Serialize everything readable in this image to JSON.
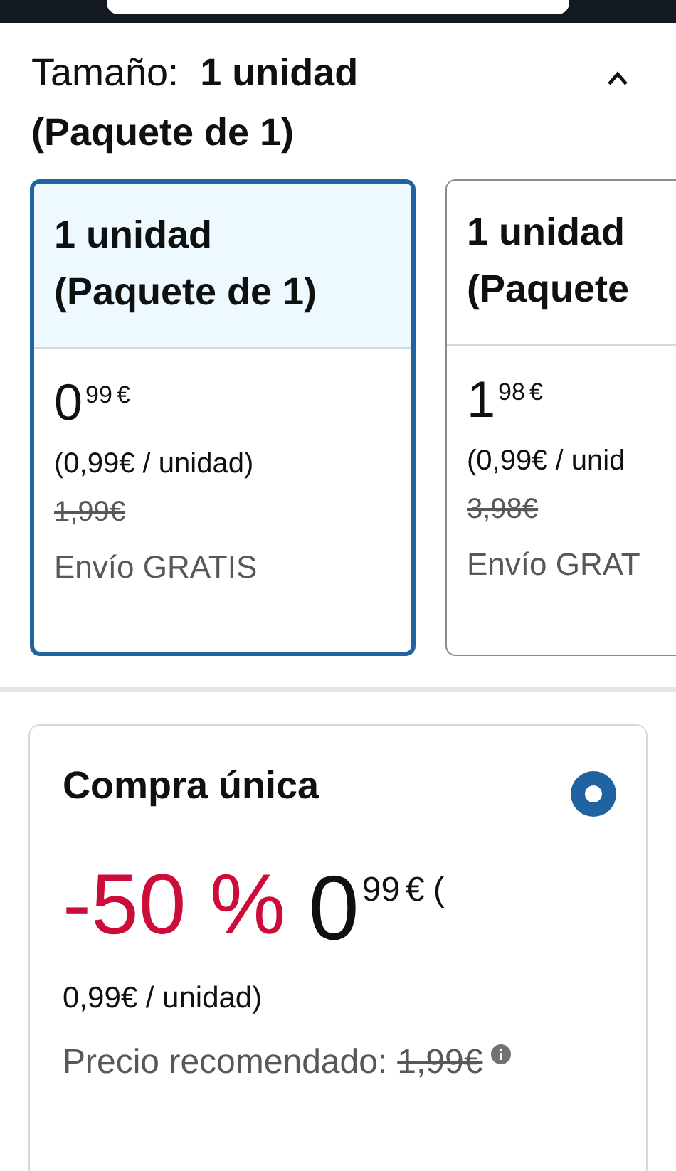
{
  "size": {
    "heading": "Tamaño:  **1 unidad (Paquete de 1)**",
    "expanded": true
  },
  "options": [
    {
      "title": "1 unidad (Paquete de 1)",
      "price_whole": "0",
      "price_fraction": "99",
      "currency": "€",
      "unit_price": "(0,99€ / unidad)",
      "list_price": "1,99€",
      "shipping": "Envío GRATIS",
      "selected": true
    },
    {
      "title": "1 unidad (Paquete",
      "price_whole": "1",
      "price_fraction": "98",
      "currency": "€",
      "unit_price": "(0,99€ / unid",
      "list_price": "3,98€",
      "shipping": "Envío GRAT",
      "selected": false
    }
  ],
  "purchase": {
    "title": "Compra única",
    "selected": true,
    "discount": "-50 %",
    "price_whole": "0",
    "price_fraction": "99",
    "currency": "€",
    "price_suffix": "(",
    "unit_price": "0,99€ / unidad)",
    "list_price_label": "Precio recomendado:",
    "list_price": "1,99€"
  }
}
